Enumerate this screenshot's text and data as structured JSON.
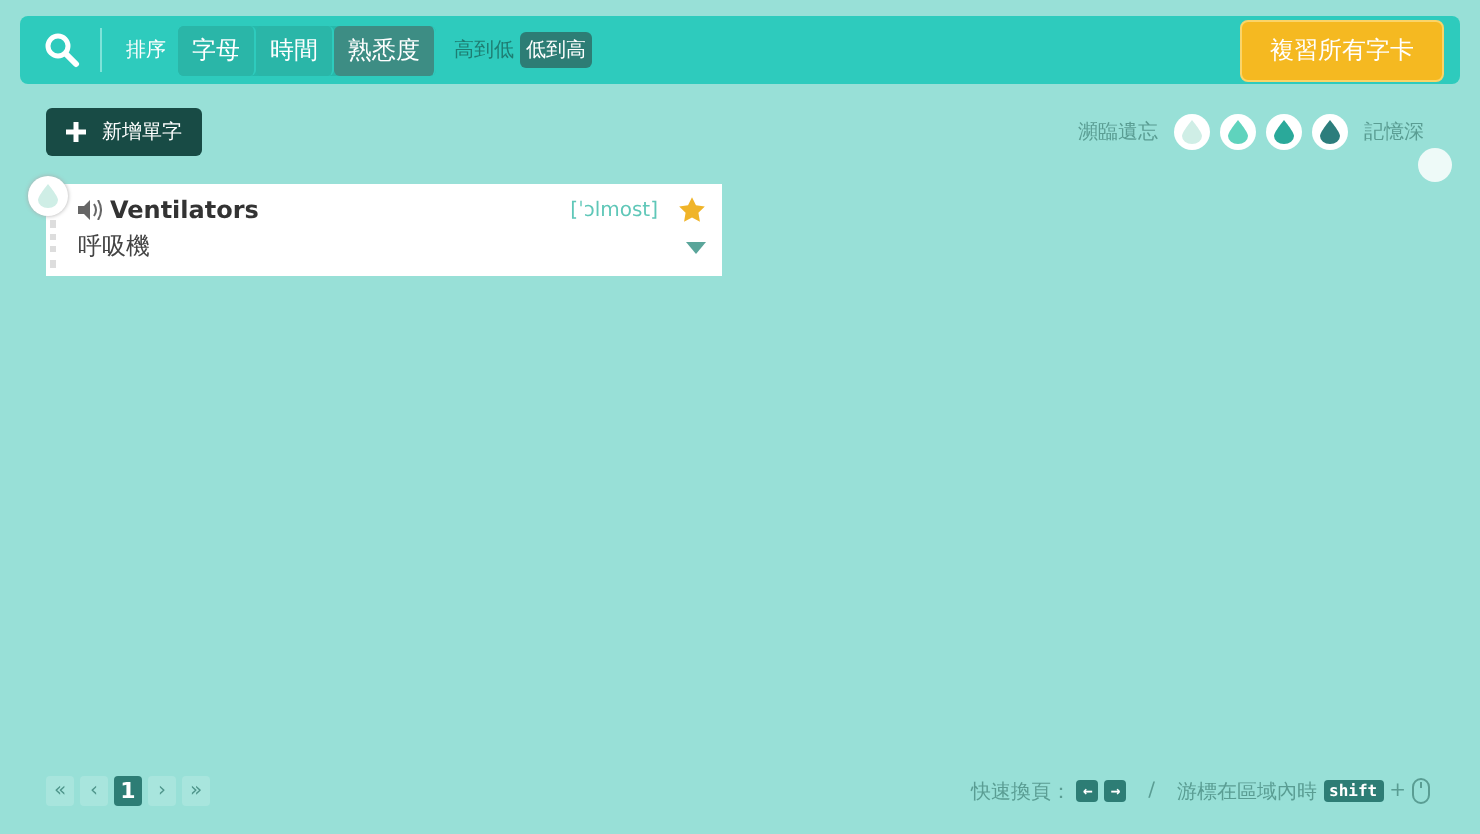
{
  "toolbar": {
    "sort_label": "排序",
    "sort_tabs": [
      {
        "label": "字母",
        "selected": false
      },
      {
        "label": "時間",
        "selected": false
      },
      {
        "label": "熟悉度",
        "selected": true
      }
    ],
    "order_options": [
      {
        "label": "高到低",
        "selected": false
      },
      {
        "label": "低到高",
        "selected": true
      }
    ],
    "review_button": "複習所有字卡"
  },
  "add_button": "新增單字",
  "legend": {
    "low_label": "瀕臨遺忘",
    "high_label": "記憶深",
    "levels": [
      {
        "color": "#cfeee6"
      },
      {
        "color": "#5fd3bd"
      },
      {
        "color": "#2aa99a"
      },
      {
        "color": "#2c7d7c"
      }
    ]
  },
  "cards": [
    {
      "word": "Ventilators",
      "phonetic": "[ˈɔlmost]",
      "meaning": "呼吸機",
      "starred": true
    }
  ],
  "pager": {
    "first": "«",
    "prev": "‹",
    "pages": [
      {
        "label": "1",
        "selected": true
      }
    ],
    "next": "›",
    "last": "»"
  },
  "shortcuts": {
    "label": "快速換頁：",
    "left_key": "←",
    "right_key": "→",
    "separator": "/",
    "hover_text": "游標在區域內時",
    "shift_key": "shift",
    "plus": "+"
  }
}
